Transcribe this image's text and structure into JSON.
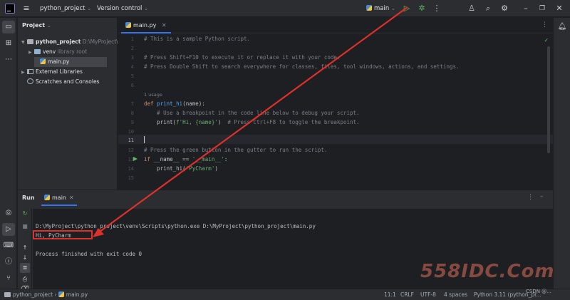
{
  "titlebar": {
    "project_name": "python_project",
    "vcs_label": "Version control",
    "run_config": "main"
  },
  "project_panel": {
    "title": "Project",
    "root_name": "python_project",
    "root_path": "D:\\MyProject\\",
    "venv_name": "venv",
    "venv_hint": "library root",
    "file_name": "main.py",
    "external_libraries": "External Libraries",
    "scratches": "Scratches and Consoles"
  },
  "editor": {
    "tab_label": "main.py",
    "usages_hint": "1 usage",
    "line_numbers": [
      "1",
      "2",
      "3",
      "4",
      "5",
      "6",
      "7",
      "8",
      "9",
      "10",
      "11",
      "12",
      "13",
      "14",
      "15"
    ],
    "line1": "# This is a sample Python script.",
    "line3": "# Press Shift+F10 to execute it or replace it with your code.",
    "line4": "# Press Double Shift to search everywhere for classes, files, tool windows, actions, and settings.",
    "line7_kw": "def",
    "line7_fn": "print_hi",
    "line7_rest": "(name):",
    "line8": "    # Use a breakpoint in the code line below to debug your script.",
    "line9_a": "    print(",
    "line9_str": "f'Hi, {name}'",
    "line9_b": ")  ",
    "line9_comment": "# Press Ctrl+F8 to toggle the breakpoint.",
    "line12": "# Press the green button in the gutter to run the script.",
    "line13_kw": "if",
    "line13_a": " __name__ == ",
    "line13_str": "'__main__'",
    "line13_b": ":",
    "line14_a": "    print_hi(",
    "line14_str": "'PyCharm'",
    "line14_b": ")"
  },
  "run_panel": {
    "title": "Run",
    "tab_label": "main",
    "command_line": "D:\\MyProject\\python_project\\venv\\Scripts\\python.exe D:\\MyProject\\python_project\\main.py",
    "output_line": "Hi, PyCharm",
    "exit_line": "Process finished with exit code 0"
  },
  "statusbar": {
    "breadcrumb_project": "python_project",
    "breadcrumb_file": "main.py",
    "position": "11:1",
    "line_ending": "CRLF",
    "encoding": "UTF-8",
    "indent": "4 spaces",
    "interpreter": "Python 3.11 (python_pr..."
  },
  "watermark": {
    "text": "558IDC.Com",
    "small": "CSDN @..."
  },
  "colors": {
    "accent": "#3574f0",
    "annotation_red": "#e0302a",
    "run_green": "#5fb865"
  }
}
